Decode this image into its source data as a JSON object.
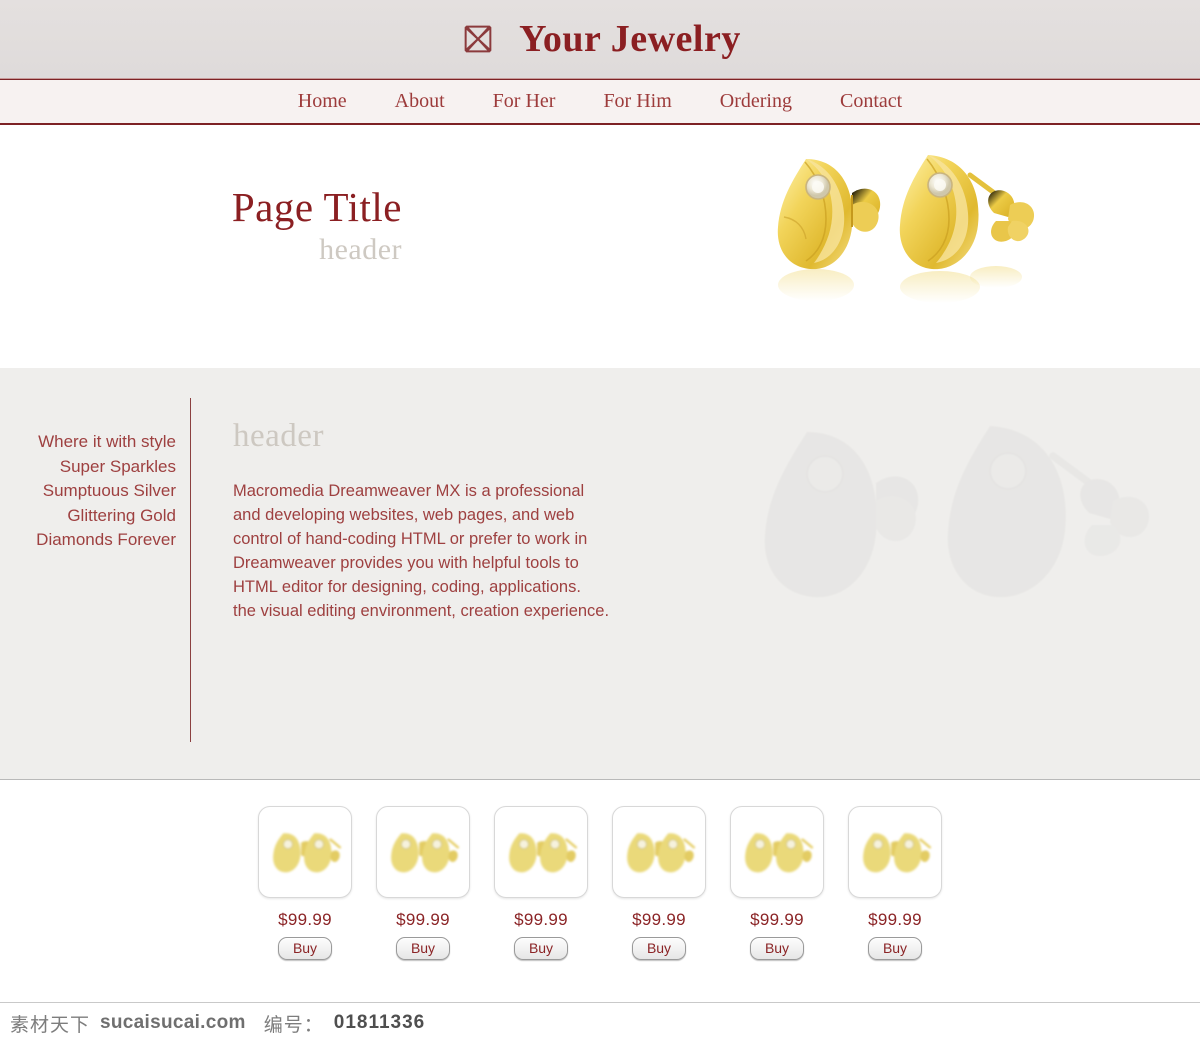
{
  "site": {
    "brand": "Your Jewelry",
    "logo_icon": "maltese-cross-icon"
  },
  "nav": {
    "items": [
      {
        "label": "Home"
      },
      {
        "label": "About"
      },
      {
        "label": "For Her"
      },
      {
        "label": "For Him"
      },
      {
        "label": "Ordering"
      },
      {
        "label": "Contact"
      }
    ]
  },
  "banner": {
    "title": "Page Title",
    "subtitle": "header",
    "image_alt": "gold-hoop-earrings"
  },
  "content": {
    "sidebar": {
      "links": [
        {
          "label": "Where it with style"
        },
        {
          "label": "Super Sparkles"
        },
        {
          "label": "Sumptuous Silver"
        },
        {
          "label": "Glittering Gold"
        },
        {
          "label": "Diamonds Forever"
        }
      ]
    },
    "article": {
      "header": "header",
      "lines": [
        "Macromedia Dreamweaver MX is a professional",
        "and developing websites, web pages, and web",
        "control of hand-coding HTML or prefer to work in",
        "Dreamweaver provides you with helpful tools to",
        "HTML editor for designing, coding, applications.",
        "the visual editing environment, creation experience."
      ]
    },
    "watermark_image_alt": "ghosted-gold-earrings"
  },
  "products": {
    "items": [
      {
        "price": "$99.99",
        "buy_label": "Buy",
        "image_alt": "gold-earrings-thumbnail"
      },
      {
        "price": "$99.99",
        "buy_label": "Buy",
        "image_alt": "gold-earrings-thumbnail"
      },
      {
        "price": "$99.99",
        "buy_label": "Buy",
        "image_alt": "gold-earrings-thumbnail"
      },
      {
        "price": "$99.99",
        "buy_label": "Buy",
        "image_alt": "gold-earrings-thumbnail"
      },
      {
        "price": "$99.99",
        "buy_label": "Buy",
        "image_alt": "gold-earrings-thumbnail"
      },
      {
        "price": "$99.99",
        "buy_label": "Buy",
        "image_alt": "gold-earrings-thumbnail"
      }
    ]
  },
  "footer_watermark": {
    "site_cn": "素材天下",
    "site_url": "sucaisucai.com",
    "id_label": "编号：",
    "id_value": "01811336"
  },
  "colors": {
    "brand_red": "#8b1f22",
    "link_red": "#9e4040",
    "nav_border": "#7d2225",
    "masthead_bg": "#e1dddc",
    "content_bg": "#efeeec",
    "muted_header": "#cdc8c1",
    "gold": "#e8c84a"
  }
}
